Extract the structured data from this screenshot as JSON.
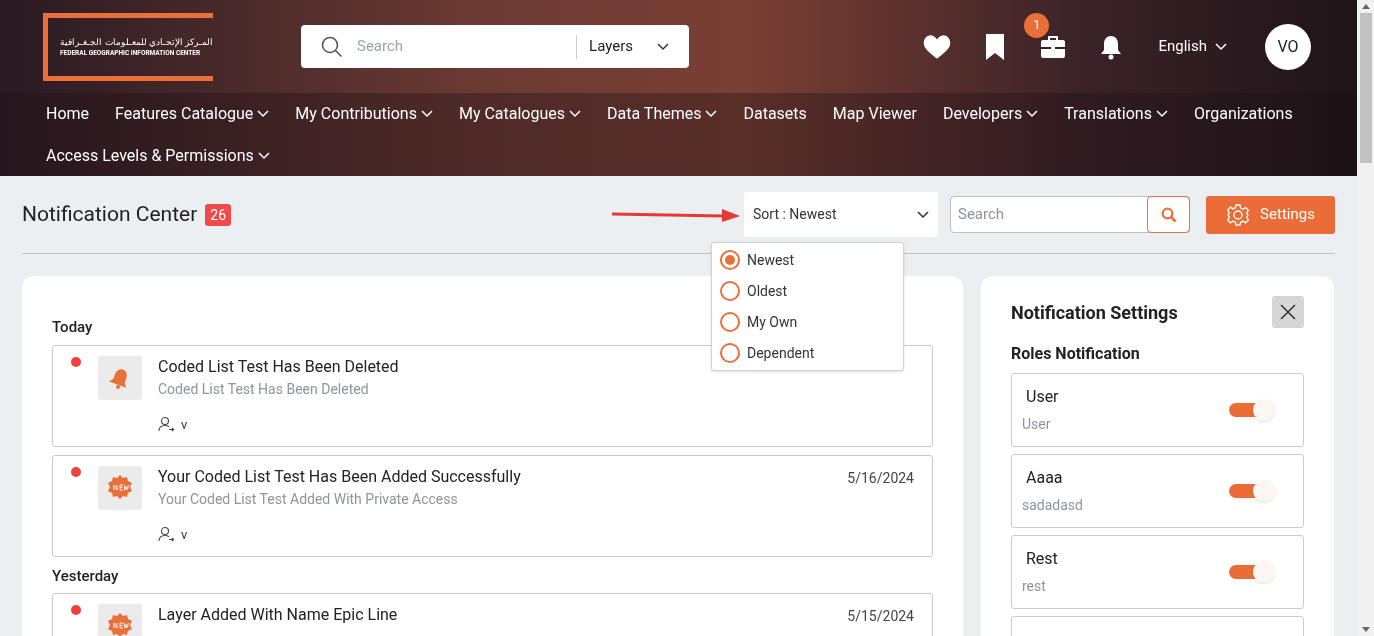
{
  "logo": {
    "arabic": "المـركز الإتحـادي للمعـلومات الجـغـرافية",
    "english": "FEDERAL GEOGRAPHIC INFORMATION CENTER"
  },
  "search": {
    "placeholder": "Search",
    "scope": "Layers"
  },
  "header_icons": [
    {
      "kind": "heart"
    },
    {
      "kind": "bookmark"
    },
    {
      "kind": "toolbox",
      "badge": "1"
    },
    {
      "kind": "bell"
    }
  ],
  "language": "English",
  "avatar": "VO",
  "nav": [
    {
      "label": "Home",
      "dropdown": false
    },
    {
      "label": "Features Catalogue",
      "dropdown": true
    },
    {
      "label": "My Contributions",
      "dropdown": true
    },
    {
      "label": "My Catalogues",
      "dropdown": true
    },
    {
      "label": "Data Themes",
      "dropdown": true
    },
    {
      "label": "Datasets",
      "dropdown": false
    },
    {
      "label": "Map Viewer",
      "dropdown": false
    },
    {
      "label": "Developers",
      "dropdown": true
    },
    {
      "label": "Translations",
      "dropdown": true
    },
    {
      "label": "Organizations",
      "dropdown": false
    },
    {
      "label": "Access Levels & Permissions",
      "dropdown": true
    }
  ],
  "page": {
    "title": "Notification Center",
    "count": "26"
  },
  "sort": {
    "label": "Sort : Newest",
    "options": [
      {
        "label": "Newest",
        "selected": true
      },
      {
        "label": "Oldest",
        "selected": false
      },
      {
        "label": "My Own",
        "selected": false
      },
      {
        "label": "Dependent",
        "selected": false
      }
    ]
  },
  "filter_search": {
    "placeholder": "Search"
  },
  "settings_button": "Settings",
  "groups": [
    {
      "label": "Today",
      "items": [
        {
          "kind": "bell",
          "unread": true,
          "title": "Coded List Test Has Been Deleted",
          "subtitle": "Coded List Test Has Been Deleted",
          "user": "v"
        },
        {
          "kind": "new",
          "unread": true,
          "title": "Your Coded List Test Has Been Added Successfully",
          "subtitle": "Your Coded List Test Added With Private Access",
          "user": "v",
          "date": "5/16/2024"
        }
      ]
    },
    {
      "label": "Yesterday",
      "items": [
        {
          "kind": "new",
          "unread": true,
          "title": "Layer Added With Name Epic Line",
          "date": "5/15/2024"
        }
      ]
    }
  ],
  "settings_panel": {
    "title": "Notification Settings",
    "section": "Roles Notification",
    "roles": [
      {
        "name": "User",
        "description": "User",
        "on": true
      },
      {
        "name": "Aaaa",
        "description": "sadadasd",
        "on": true
      },
      {
        "name": "Rest",
        "description": "rest",
        "on": true
      }
    ]
  }
}
